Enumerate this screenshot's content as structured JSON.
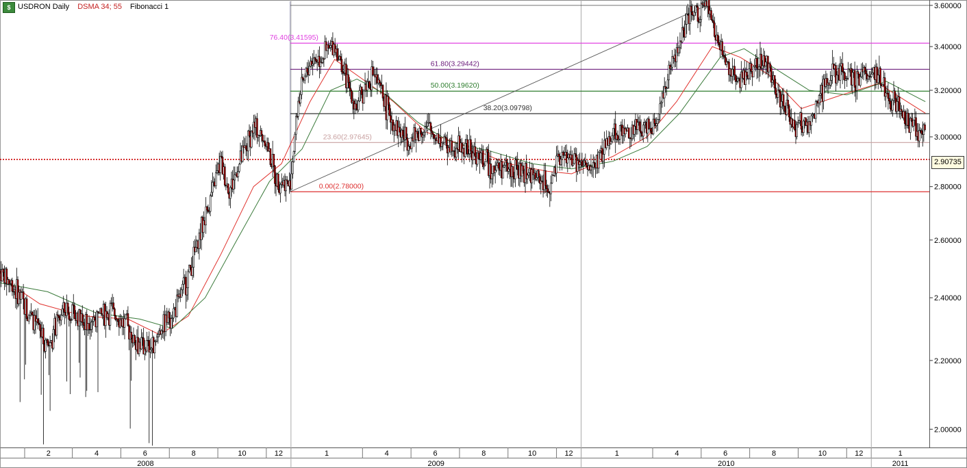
{
  "header": {
    "symbol_label": "USDRON Daily",
    "indicator_label": "DSMA 34; 55",
    "study_label": "Fibonacci 1"
  },
  "colors": {
    "candle": "#000000",
    "sma_fast": "#e0312c",
    "sma_slow": "#3a7a3a",
    "current_price": "#cc0000",
    "fib_764": "#e040e0",
    "fib_618": "#6a1a7a",
    "fib_500": "#2e7d2e",
    "fib_382": "#333333",
    "fib_236": "#c8a0a0",
    "fib_000": "#dd3030"
  },
  "chart_data": {
    "type": "candlestick",
    "symbol": "USDRON",
    "timeframe": "Daily",
    "y_axis": {
      "scale": "log",
      "range": [
        1.95,
        3.62
      ],
      "ticks": [
        "3.60000",
        "3.40000",
        "3.20000",
        "3.00000",
        "2.80000",
        "2.60000",
        "2.40000",
        "2.20000",
        "2.00000"
      ]
    },
    "current_price": "2.90735",
    "x_axis": {
      "start": "2008-01",
      "end": "2011-03",
      "month_ticks": [
        {
          "label": "2",
          "date": "2008-02"
        },
        {
          "label": "4",
          "date": "2008-04"
        },
        {
          "label": "6",
          "date": "2008-06"
        },
        {
          "label": "8",
          "date": "2008-08"
        },
        {
          "label": "10",
          "date": "2008-10"
        },
        {
          "label": "12",
          "date": "2008-12"
        },
        {
          "label": "1",
          "date": "2009-01"
        },
        {
          "label": "4",
          "date": "2009-04"
        },
        {
          "label": "6",
          "date": "2009-06"
        },
        {
          "label": "8",
          "date": "2009-08"
        },
        {
          "label": "10",
          "date": "2009-10"
        },
        {
          "label": "12",
          "date": "2009-12"
        },
        {
          "label": "1",
          "date": "2010-01"
        },
        {
          "label": "4",
          "date": "2010-04"
        },
        {
          "label": "6",
          "date": "2010-06"
        },
        {
          "label": "8",
          "date": "2010-08"
        },
        {
          "label": "10",
          "date": "2010-10"
        },
        {
          "label": "12",
          "date": "2010-12"
        },
        {
          "label": "1",
          "date": "2011-01"
        }
      ],
      "years": [
        {
          "label": "2008",
          "date": "2008-01"
        },
        {
          "label": "2009",
          "date": "2009-01"
        },
        {
          "label": "2010",
          "date": "2010-01"
        },
        {
          "label": "2011",
          "date": "2011-01"
        }
      ]
    },
    "fibonacci": {
      "anchor_low": {
        "date": "2008-12-31",
        "price": 2.78
      },
      "anchor_high": {
        "date": "2010-06-08",
        "price": 3.6
      },
      "levels": [
        {
          "label": "76.40(3.41595)",
          "price": 3.41595,
          "color_key": "fib_764"
        },
        {
          "label": "61.80(3.29442)",
          "price": 3.29442,
          "color_key": "fib_618"
        },
        {
          "label": "50.00(3.19620)",
          "price": 3.1962,
          "color_key": "fib_500"
        },
        {
          "label": "38.20(3.09798)",
          "price": 3.09798,
          "color_key": "fib_382"
        },
        {
          "label": "23.60(2.97645)",
          "price": 2.97645,
          "color_key": "fib_236"
        },
        {
          "label": "0.00(2.78000)",
          "price": 2.78,
          "color_key": "fib_000"
        }
      ]
    },
    "price_path": [
      [
        "2008-01-01",
        2.49
      ],
      [
        "2008-01-20",
        2.43
      ],
      [
        "2008-02-10",
        2.33
      ],
      [
        "2008-03-01",
        2.24
      ],
      [
        "2008-03-20",
        2.36
      ],
      [
        "2008-04-10",
        2.33
      ],
      [
        "2008-05-01",
        2.33
      ],
      [
        "2008-05-20",
        2.36
      ],
      [
        "2008-06-10",
        2.3
      ],
      [
        "2008-06-25",
        2.25
      ],
      [
        "2008-07-10",
        2.24
      ],
      [
        "2008-07-25",
        2.32
      ],
      [
        "2008-08-10",
        2.37
      ],
      [
        "2008-08-25",
        2.48
      ],
      [
        "2008-09-05",
        2.58
      ],
      [
        "2008-09-20",
        2.74
      ],
      [
        "2008-10-05",
        2.9
      ],
      [
        "2008-10-15",
        2.78
      ],
      [
        "2008-11-01",
        2.92
      ],
      [
        "2008-11-15",
        3.04
      ],
      [
        "2008-12-01",
        2.98
      ],
      [
        "2008-12-12",
        2.84
      ],
      [
        "2008-12-31",
        2.8
      ],
      [
        "2009-01-10",
        3.15
      ],
      [
        "2009-01-25",
        3.33
      ],
      [
        "2009-02-10",
        3.36
      ],
      [
        "2009-02-25",
        3.41
      ],
      [
        "2009-03-10",
        3.26
      ],
      [
        "2009-03-25",
        3.12
      ],
      [
        "2009-04-05",
        3.22
      ],
      [
        "2009-04-15",
        3.28
      ],
      [
        "2009-05-01",
        3.13
      ],
      [
        "2009-05-15",
        3.03
      ],
      [
        "2009-06-01",
        2.98
      ],
      [
        "2009-06-20",
        3.04
      ],
      [
        "2009-07-10",
        2.98
      ],
      [
        "2009-08-01",
        2.96
      ],
      [
        "2009-08-20",
        2.93
      ],
      [
        "2009-09-10",
        2.88
      ],
      [
        "2009-10-01",
        2.87
      ],
      [
        "2009-10-20",
        2.86
      ],
      [
        "2009-11-10",
        2.83
      ],
      [
        "2009-11-22",
        2.79
      ],
      [
        "2009-12-05",
        2.92
      ],
      [
        "2009-12-20",
        2.91
      ],
      [
        "2010-01-10",
        2.86
      ],
      [
        "2010-01-25",
        2.92
      ],
      [
        "2010-02-10",
        3.02
      ],
      [
        "2010-03-01",
        3.02
      ],
      [
        "2010-03-20",
        3.04
      ],
      [
        "2010-04-05",
        3.07
      ],
      [
        "2010-04-20",
        3.25
      ],
      [
        "2010-05-05",
        3.42
      ],
      [
        "2010-05-20",
        3.55
      ],
      [
        "2010-06-08",
        3.6
      ],
      [
        "2010-06-20",
        3.44
      ],
      [
        "2010-07-05",
        3.31
      ],
      [
        "2010-07-20",
        3.24
      ],
      [
        "2010-08-10",
        3.33
      ],
      [
        "2010-08-25",
        3.31
      ],
      [
        "2010-09-10",
        3.15
      ],
      [
        "2010-09-25",
        3.05
      ],
      [
        "2010-10-15",
        3.04
      ],
      [
        "2010-11-05",
        3.25
      ],
      [
        "2010-11-25",
        3.28
      ],
      [
        "2010-12-15",
        3.24
      ],
      [
        "2011-01-05",
        3.3
      ],
      [
        "2011-01-20",
        3.18
      ],
      [
        "2011-02-05",
        3.12
      ],
      [
        "2011-02-25",
        3.04
      ],
      [
        "2011-03-10",
        3.02
      ]
    ],
    "series": [
      {
        "name": "DSMA 34",
        "color_key": "sma_fast",
        "points": [
          [
            "2008-01-01",
            2.47
          ],
          [
            "2008-02-20",
            2.38
          ],
          [
            "2008-04-15",
            2.34
          ],
          [
            "2008-06-10",
            2.33
          ],
          [
            "2008-07-20",
            2.28
          ],
          [
            "2008-08-25",
            2.34
          ],
          [
            "2008-10-05",
            2.55
          ],
          [
            "2008-11-15",
            2.8
          ],
          [
            "2008-12-20",
            2.89
          ],
          [
            "2009-01-25",
            3.15
          ],
          [
            "2009-02-25",
            3.34
          ],
          [
            "2009-04-01",
            3.25
          ],
          [
            "2009-05-10",
            3.15
          ],
          [
            "2009-06-20",
            3.02
          ],
          [
            "2009-08-10",
            2.96
          ],
          [
            "2009-10-01",
            2.89
          ],
          [
            "2009-11-20",
            2.86
          ],
          [
            "2009-12-20",
            2.85
          ],
          [
            "2010-02-10",
            2.92
          ],
          [
            "2010-03-25",
            3.0
          ],
          [
            "2010-05-01",
            3.15
          ],
          [
            "2010-06-15",
            3.4
          ],
          [
            "2010-07-20",
            3.35
          ],
          [
            "2010-08-25",
            3.27
          ],
          [
            "2010-10-05",
            3.12
          ],
          [
            "2010-11-25",
            3.18
          ],
          [
            "2011-01-10",
            3.23
          ],
          [
            "2011-03-10",
            3.1
          ]
        ]
      },
      {
        "name": "DSMA 55",
        "color_key": "sma_slow",
        "points": [
          [
            "2008-01-01",
            2.45
          ],
          [
            "2008-03-01",
            2.42
          ],
          [
            "2008-05-01",
            2.35
          ],
          [
            "2008-06-25",
            2.33
          ],
          [
            "2008-08-05",
            2.3
          ],
          [
            "2008-09-15",
            2.4
          ],
          [
            "2008-10-25",
            2.6
          ],
          [
            "2008-12-05",
            2.82
          ],
          [
            "2009-01-15",
            2.95
          ],
          [
            "2009-02-20",
            3.2
          ],
          [
            "2009-03-25",
            3.25
          ],
          [
            "2009-05-01",
            3.18
          ],
          [
            "2009-06-10",
            3.06
          ],
          [
            "2009-07-20",
            2.98
          ],
          [
            "2009-09-10",
            2.94
          ],
          [
            "2009-11-01",
            2.89
          ],
          [
            "2009-12-20",
            2.87
          ],
          [
            "2010-02-10",
            2.9
          ],
          [
            "2010-03-25",
            2.96
          ],
          [
            "2010-05-05",
            3.1
          ],
          [
            "2010-06-25",
            3.35
          ],
          [
            "2010-07-25",
            3.39
          ],
          [
            "2010-09-01",
            3.3
          ],
          [
            "2010-10-15",
            3.2
          ],
          [
            "2010-12-01",
            3.18
          ],
          [
            "2011-01-20",
            3.24
          ],
          [
            "2011-03-10",
            3.15
          ]
        ]
      }
    ],
    "trend_line": {
      "from": {
        "date": "2008-12-31",
        "price": 2.78
      },
      "to": {
        "date": "2010-06-08",
        "price": 3.6
      }
    }
  }
}
